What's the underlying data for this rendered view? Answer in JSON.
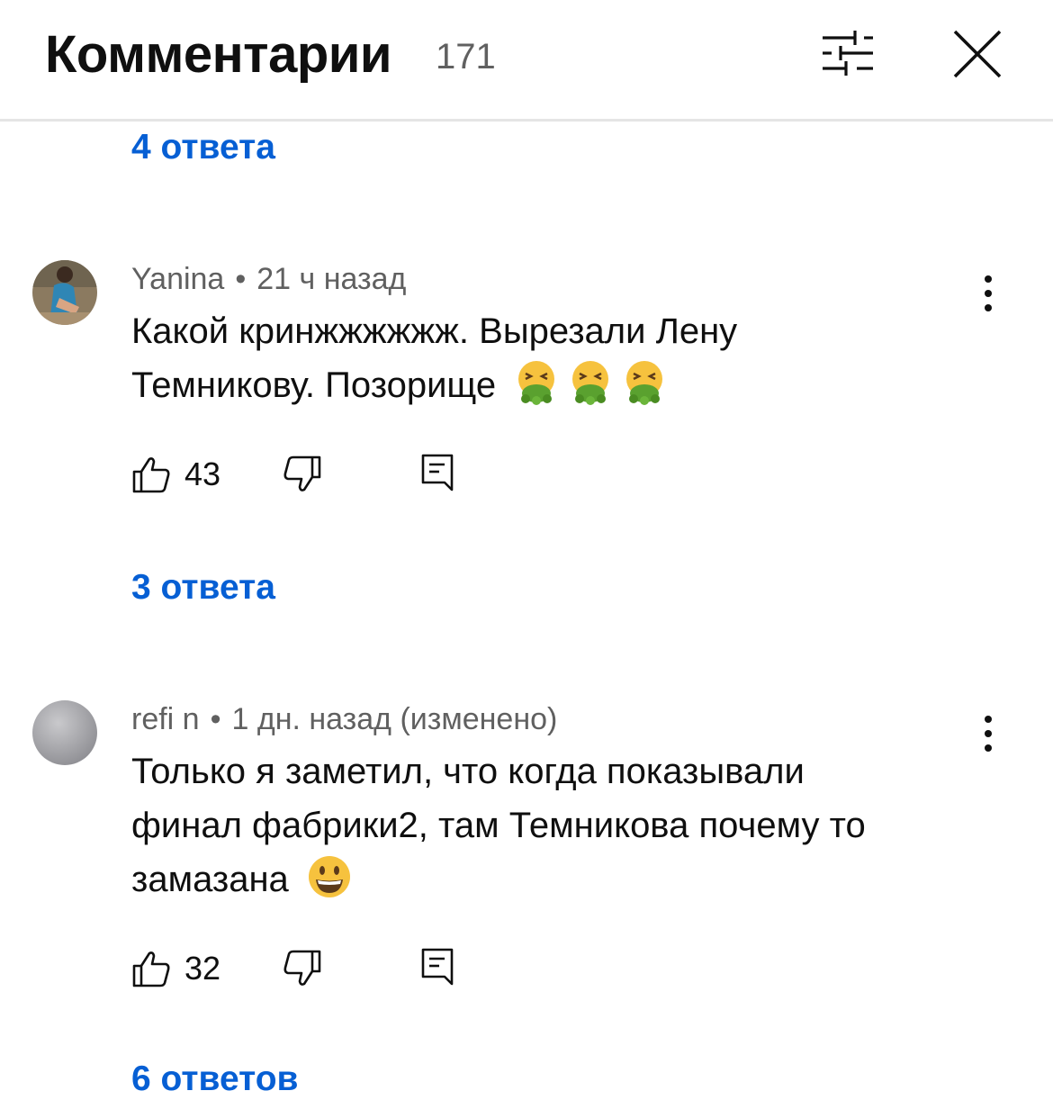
{
  "header": {
    "title": "Комментарии",
    "count": "171",
    "filter_icon": "sliders-icon",
    "close_icon": "close-icon"
  },
  "replies_top": "4 ответа",
  "comments": [
    {
      "author": "Yanina",
      "time": "21 ч назад",
      "text_line1": "Какой кринжжжжжж. Вырезали Лену",
      "text_line2": "Темникову. Позорище",
      "emojis": [
        "vomiting-face-emoji",
        "vomiting-face-emoji",
        "vomiting-face-emoji"
      ],
      "likes": "43",
      "replies": "3 ответа"
    },
    {
      "author": "refi n",
      "time": "1 дн. назад (изменено)",
      "text_line1": "Только я заметил, что когда показывали",
      "text_line2": "финал фабрики2, там Темникова почему то",
      "text_line3": "замазана",
      "emojis": [
        "grinning-face-emoji"
      ],
      "likes": "32",
      "replies": "6 ответов"
    }
  ],
  "meta_separator": "•",
  "colors": {
    "link": "#065fd4",
    "secondary_text": "#606060",
    "primary_text": "#0f0f0f",
    "divider": "#e5e5e5"
  }
}
